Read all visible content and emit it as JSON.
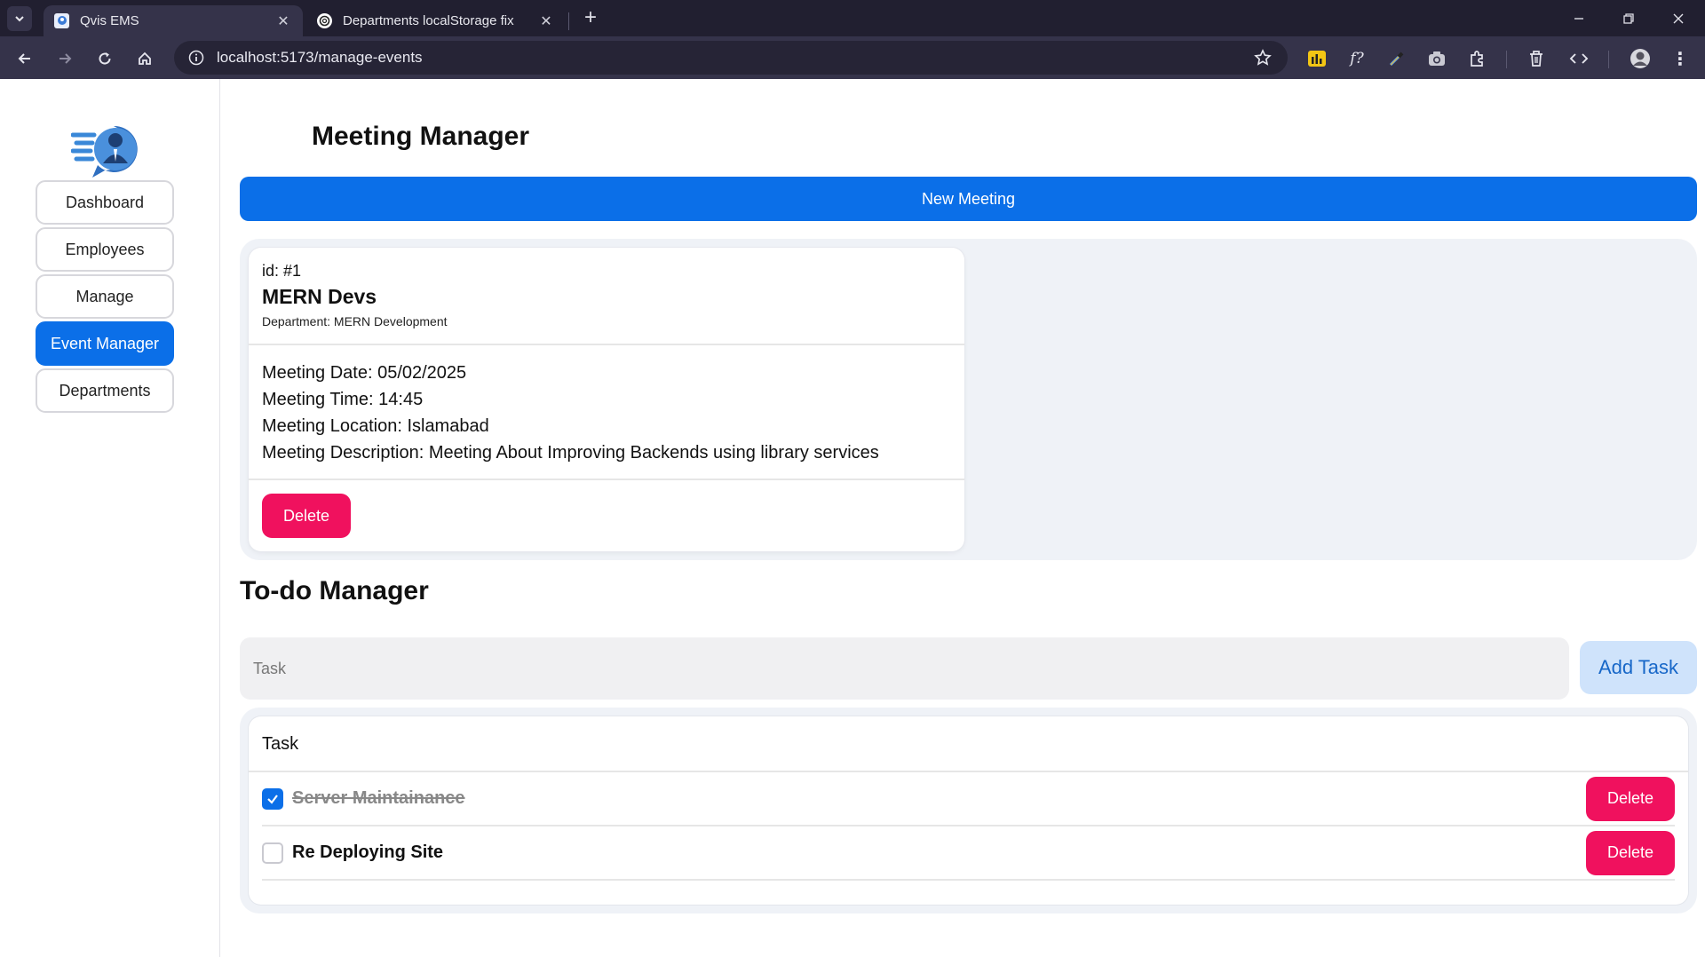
{
  "browser": {
    "tabs": [
      {
        "title": "Qvis EMS",
        "active": true,
        "icon": "qvis-favicon"
      },
      {
        "title": "Departments localStorage fix",
        "active": false,
        "icon": "openai-favicon"
      }
    ],
    "url": "localhost:5173/manage-events",
    "accent": "#35334a"
  },
  "sidebar": {
    "items": [
      {
        "label": "Dashboard",
        "active": false
      },
      {
        "label": "Employees",
        "active": false
      },
      {
        "label": "Manage",
        "active": false
      },
      {
        "label": "Event Manager",
        "active": true
      },
      {
        "label": "Departments",
        "active": false
      }
    ]
  },
  "meetings": {
    "title": "Meeting Manager",
    "new_button": "New Meeting",
    "cards": [
      {
        "id": "id: #1",
        "name": "MERN Devs",
        "department": "Department: MERN Development",
        "date": "Meeting Date: 05/02/2025",
        "time": "Meeting Time: 14:45",
        "location": "Meeting Location: Islamabad",
        "description": "Meeting Description: Meeting About Improving Backends using library services",
        "delete_label": "Delete"
      }
    ]
  },
  "todo": {
    "title": "To-do Manager",
    "input_placeholder": "Task",
    "add_button": "Add Task",
    "header": "Task",
    "items": [
      {
        "text": "Server Maintainance",
        "done": true,
        "delete_label": "Delete"
      },
      {
        "text": "Re Deploying Site",
        "done": false,
        "delete_label": "Delete"
      }
    ]
  },
  "colors": {
    "primary": "#0b6fe8",
    "danger": "#f0115e",
    "panel": "#eff2f7"
  }
}
